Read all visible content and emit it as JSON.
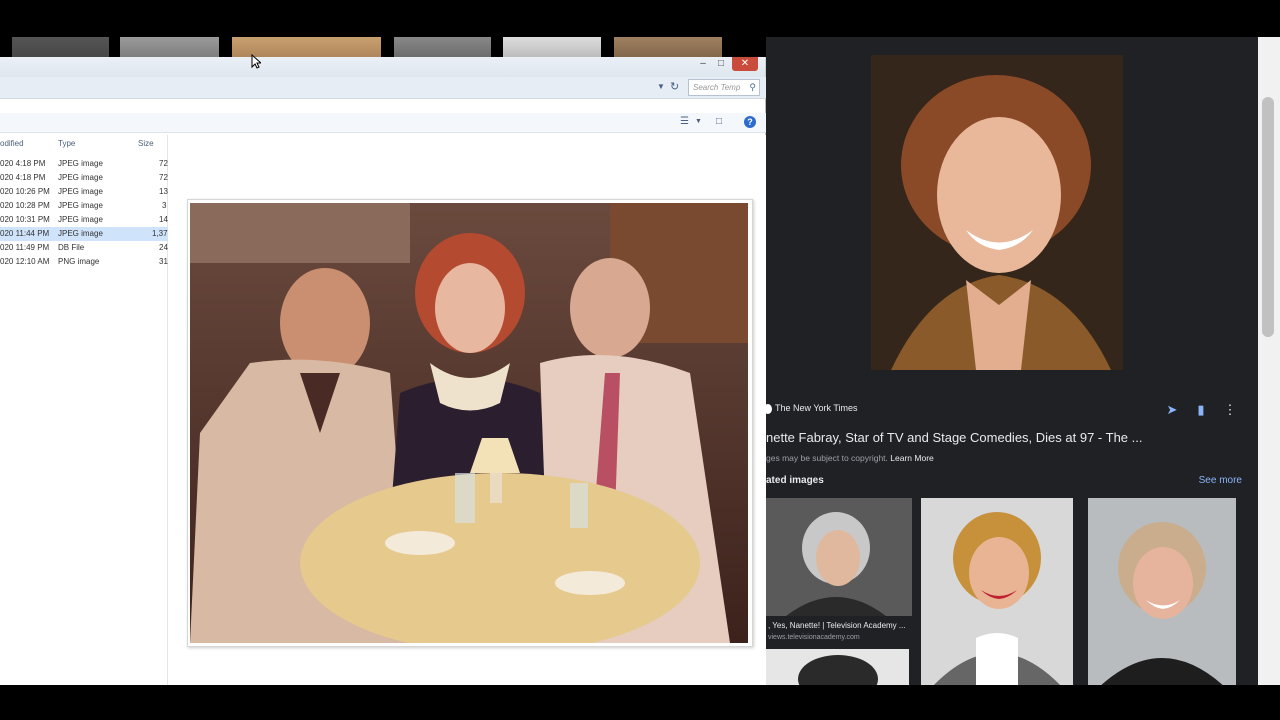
{
  "explorer": {
    "search_placeholder": "Search Temp",
    "columns": {
      "modified": "odified",
      "type": "Type",
      "size": "Size"
    },
    "files": [
      {
        "modified": "020 4:18 PM",
        "type": "JPEG image",
        "size": "72",
        "selected": false
      },
      {
        "modified": "020 4:18 PM",
        "type": "JPEG image",
        "size": "72",
        "selected": false
      },
      {
        "modified": "020 10:26 PM",
        "type": "JPEG image",
        "size": "13",
        "selected": false
      },
      {
        "modified": "020 10:28 PM",
        "type": "JPEG image",
        "size": "3",
        "selected": false
      },
      {
        "modified": "020 10:31 PM",
        "type": "JPEG image",
        "size": "14",
        "selected": false
      },
      {
        "modified": "020 11:44 PM",
        "type": "JPEG image",
        "size": "1,37",
        "selected": true
      },
      {
        "modified": "020 11:49 PM",
        "type": "DB File",
        "size": "24",
        "selected": false
      },
      {
        "modified": "020 12:10 AM",
        "type": "PNG image",
        "size": "31",
        "selected": false
      }
    ],
    "help_label": "?"
  },
  "google": {
    "source": "The New York Times",
    "headline": "nette Fabray, Star of TV and Stage Comedies, Dies at 97 - The ...",
    "copyright_text": "ges may be subject to copyright.",
    "learn_more": "Learn More",
    "related_heading": "ated images",
    "see_more": "See more",
    "related": [
      {
        "caption": ", Yes, Nanette! | Television Academy ...",
        "domain": "views.televisionacademy.com"
      }
    ]
  },
  "colors": {
    "google_bg": "#202124",
    "link_blue": "#8ab4f8",
    "selection": "#cfe3fb"
  }
}
